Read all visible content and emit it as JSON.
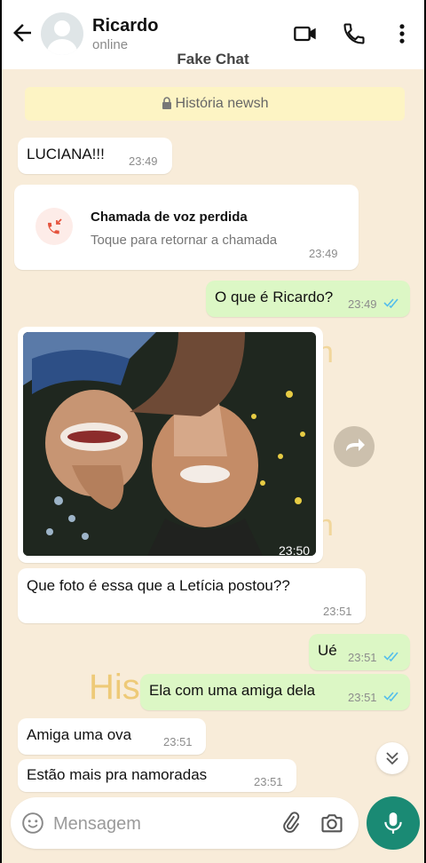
{
  "header": {
    "contact_name": "Ricardo",
    "status": "online",
    "watermark_title": "Fake Chat"
  },
  "banner": {
    "text": "História newsh"
  },
  "messages": [
    {
      "id": 1,
      "direction": "incoming",
      "text": "LUCIANA!!!",
      "time": "23:49"
    },
    {
      "id": 2,
      "direction": "incoming",
      "type": "missed_call",
      "title": "Chamada de voz perdida",
      "subtitle": "Toque para retornar a chamada",
      "time": "23:49"
    },
    {
      "id": 3,
      "direction": "outgoing",
      "text": "O que é Ricardo?",
      "time": "23:49",
      "read": true
    },
    {
      "id": 4,
      "direction": "incoming",
      "type": "photo",
      "time": "23:50"
    },
    {
      "id": 5,
      "direction": "incoming",
      "text": "Que foto é essa que a Letícia postou??",
      "time": "23:51"
    },
    {
      "id": 6,
      "direction": "outgoing",
      "text": "Ué",
      "time": "23:51",
      "read": true
    },
    {
      "id": 7,
      "direction": "outgoing",
      "text": "Ela com uma amiga dela",
      "time": "23:51",
      "read": true
    },
    {
      "id": 8,
      "direction": "incoming",
      "text": "Amiga uma ova",
      "time": "23:51"
    },
    {
      "id": 9,
      "direction": "incoming",
      "text": "Estão mais pra namoradas",
      "time": "23:51"
    }
  ],
  "background_watermark": "His",
  "background_watermark_fragment": "n",
  "composer": {
    "placeholder": "Mensagem"
  },
  "colors": {
    "background": "#f8ecd9",
    "outgoing_bubble": "#dcf7c5",
    "incoming_bubble": "#ffffff",
    "accent": "#1a8a74",
    "read_ticks": "#53bdeb",
    "missed_call": "#e5533d"
  },
  "icons": {
    "back": "arrow-left-icon",
    "video": "video-camera-icon",
    "call": "phone-icon",
    "menu": "more-vertical-icon",
    "lock": "lock-icon",
    "emoji": "emoji-icon",
    "attach": "paperclip-icon",
    "camera": "camera-icon",
    "mic": "microphone-icon"
  }
}
